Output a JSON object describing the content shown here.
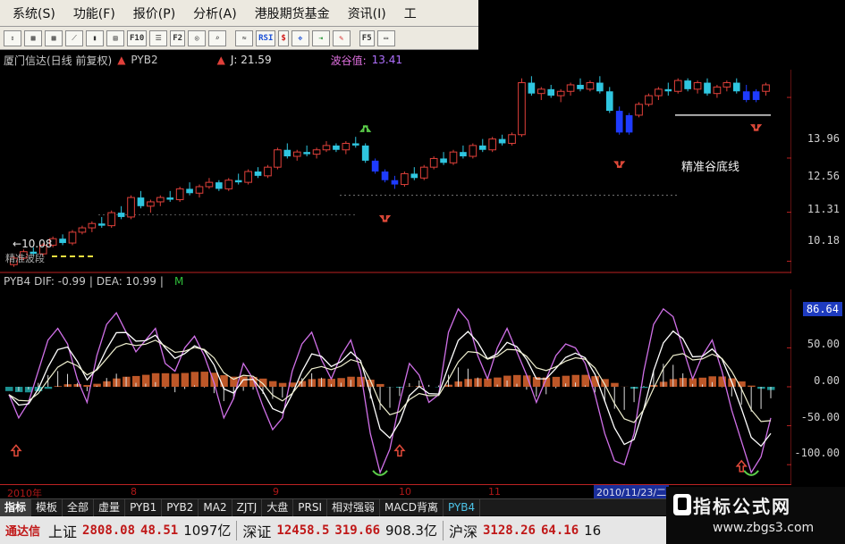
{
  "menu": [
    "系统(S)",
    "功能(F)",
    "报价(P)",
    "分析(A)",
    "港股期货基金",
    "资讯(I)",
    "工"
  ],
  "toolbar": {
    "buttons": [
      {
        "label": "",
        "icon": "arrow-updown-icon"
      },
      {
        "label": "",
        "icon": "grid-icon"
      },
      {
        "label": "",
        "icon": "grid-icon"
      },
      {
        "label": "",
        "icon": "line-chart-icon"
      },
      {
        "label": "",
        "icon": "candle-chart-icon"
      },
      {
        "label": "",
        "icon": "pane-icon"
      },
      {
        "label": "F10",
        "icon": "f10-icon"
      },
      {
        "label": "",
        "icon": "list-icon"
      },
      {
        "label": "F2",
        "icon": "f2-icon"
      },
      {
        "label": "",
        "icon": "scope-icon"
      },
      {
        "label": "",
        "icon": "search-icon"
      },
      {
        "label": "",
        "icon": "wave-icon"
      },
      {
        "label": "RSI",
        "icon": "rsi-icon"
      },
      {
        "label": "$",
        "icon": "dollar-icon"
      },
      {
        "label": "",
        "icon": "move-icon"
      },
      {
        "label": "",
        "icon": "export-icon"
      },
      {
        "label": "",
        "icon": "pencil-icon"
      },
      {
        "label": "F5",
        "icon": "f5-icon"
      },
      {
        "label": "",
        "icon": "window-icon"
      }
    ]
  },
  "price_panel": {
    "stock": "厦门信达(日线 前复权)",
    "indicator": "PYB2",
    "j_label": "J: 21.59",
    "valley_label": "波谷值:",
    "valley_value": "13.41",
    "low_price": "10.08",
    "faint_tag": "精准波段",
    "annotation": "精准谷底线"
  },
  "osc_panel": {
    "name": "PYB4",
    "dif": "DIF: -0.99",
    "dea": "DEA: 10.99",
    "m": "M"
  },
  "price_axis": [
    "13.96",
    "12.56",
    "11.31",
    "10.18"
  ],
  "osc_axis": [
    "50.00",
    "0.00",
    "-50.00",
    "-100.00"
  ],
  "osc_current": "86.64",
  "dates": [
    "2010年",
    "8",
    "9",
    "10",
    "11"
  ],
  "date_current": "2010/11/23/二",
  "tabs": [
    "指标",
    "模板",
    "全部",
    "虚量",
    "PYB1",
    "PYB2",
    "MA2",
    "ZJTJ",
    "大盘",
    "PRSI",
    "相对强弱",
    "MACD背离",
    "PYB4"
  ],
  "ticker": {
    "brand": "通达信",
    "items": [
      {
        "name": "上证",
        "value": "2808.08",
        "change": "48.51",
        "volume": "1097亿"
      },
      {
        "name": "深证",
        "value": "12458.5",
        "change": "319.66",
        "volume": "908.3亿"
      },
      {
        "name": "沪深",
        "value": "3128.26",
        "change": "64.16",
        "volume": "16"
      }
    ]
  },
  "logo": {
    "title": "指标公式网",
    "url": "www.zbgs3.com"
  },
  "chart_data": {
    "type": "candlestick",
    "colors": {
      "up": "#e0403a",
      "down": "#2fc6e0",
      "valley": "#1e3bff",
      "dif": "#ffffff",
      "k": "#d070e8",
      "dea": "#f0f0d0"
    },
    "ohlc": [
      [
        10.1,
        10.3,
        10.05,
        10.25
      ],
      [
        10.25,
        10.45,
        10.2,
        10.4
      ],
      [
        10.4,
        10.5,
        10.3,
        10.35
      ],
      [
        10.35,
        10.6,
        10.3,
        10.55
      ],
      [
        10.55,
        10.75,
        10.5,
        10.7
      ],
      [
        10.7,
        10.8,
        10.55,
        10.6
      ],
      [
        10.6,
        10.9,
        10.55,
        10.85
      ],
      [
        10.85,
        11.0,
        10.8,
        10.95
      ],
      [
        10.95,
        11.1,
        10.85,
        11.05
      ],
      [
        11.05,
        11.2,
        10.95,
        11.0
      ],
      [
        11.0,
        11.35,
        10.95,
        11.3
      ],
      [
        11.3,
        11.45,
        11.15,
        11.2
      ],
      [
        11.2,
        11.7,
        11.15,
        11.65
      ],
      [
        11.65,
        11.8,
        11.4,
        11.45
      ],
      [
        11.45,
        11.6,
        11.3,
        11.55
      ],
      [
        11.55,
        11.7,
        11.45,
        11.65
      ],
      [
        11.65,
        11.8,
        11.55,
        11.6
      ],
      [
        11.6,
        11.9,
        11.55,
        11.85
      ],
      [
        11.85,
        12.0,
        11.7,
        11.75
      ],
      [
        11.75,
        11.95,
        11.65,
        11.9
      ],
      [
        11.9,
        12.1,
        11.85,
        12.0
      ],
      [
        12.0,
        12.05,
        11.8,
        11.85
      ],
      [
        11.85,
        12.1,
        11.8,
        12.05
      ],
      [
        12.05,
        12.2,
        11.95,
        12.0
      ],
      [
        12.0,
        12.3,
        11.95,
        12.25
      ],
      [
        12.25,
        12.35,
        12.1,
        12.15
      ],
      [
        12.15,
        12.4,
        12.1,
        12.35
      ],
      [
        12.35,
        12.8,
        12.3,
        12.75
      ],
      [
        12.75,
        12.9,
        12.55,
        12.6
      ],
      [
        12.6,
        12.75,
        12.5,
        12.7
      ],
      [
        12.7,
        12.85,
        12.6,
        12.65
      ],
      [
        12.65,
        12.8,
        12.55,
        12.75
      ],
      [
        12.75,
        12.95,
        12.7,
        12.85
      ],
      [
        12.85,
        12.9,
        12.7,
        12.75
      ],
      [
        12.75,
        12.95,
        12.65,
        12.9
      ],
      [
        12.9,
        13.05,
        12.8,
        12.85
      ],
      [
        12.85,
        12.9,
        12.45,
        12.5
      ],
      [
        12.5,
        12.55,
        12.2,
        12.25
      ],
      [
        12.25,
        12.3,
        12.0,
        12.05
      ],
      [
        12.05,
        12.15,
        11.85,
        11.95
      ],
      [
        11.95,
        12.25,
        11.9,
        12.2
      ],
      [
        12.2,
        12.35,
        12.05,
        12.1
      ],
      [
        12.1,
        12.4,
        12.05,
        12.35
      ],
      [
        12.35,
        12.6,
        12.3,
        12.55
      ],
      [
        12.55,
        12.7,
        12.4,
        12.45
      ],
      [
        12.45,
        12.75,
        12.4,
        12.7
      ],
      [
        12.7,
        12.85,
        12.55,
        12.6
      ],
      [
        12.6,
        12.9,
        12.55,
        12.85
      ],
      [
        12.85,
        13.0,
        12.7,
        12.75
      ],
      [
        12.75,
        13.05,
        12.7,
        13.0
      ],
      [
        13.0,
        13.1,
        12.85,
        12.9
      ],
      [
        12.9,
        13.15,
        12.85,
        13.1
      ],
      [
        13.1,
        14.4,
        13.05,
        14.3
      ],
      [
        14.3,
        14.45,
        14.0,
        14.05
      ],
      [
        14.05,
        14.2,
        13.9,
        14.15
      ],
      [
        14.15,
        14.25,
        13.95,
        14.0
      ],
      [
        14.0,
        14.15,
        13.85,
        14.1
      ],
      [
        14.1,
        14.3,
        14.0,
        14.25
      ],
      [
        14.25,
        14.4,
        14.1,
        14.15
      ],
      [
        14.15,
        14.35,
        14.1,
        14.3
      ],
      [
        14.3,
        14.45,
        14.05,
        14.1
      ],
      [
        14.1,
        14.2,
        13.6,
        13.65
      ],
      [
        13.65,
        13.75,
        13.1,
        13.15
      ],
      [
        13.15,
        13.6,
        13.1,
        13.55
      ],
      [
        13.55,
        13.85,
        13.5,
        13.8
      ],
      [
        13.8,
        14.05,
        13.75,
        14.0
      ],
      [
        14.0,
        14.2,
        13.9,
        14.15
      ],
      [
        14.15,
        14.3,
        14.0,
        14.1
      ],
      [
        14.1,
        14.4,
        14.05,
        14.35
      ],
      [
        14.35,
        14.4,
        14.1,
        14.15
      ],
      [
        14.15,
        14.35,
        14.05,
        14.3
      ],
      [
        14.3,
        14.4,
        14.0,
        14.05
      ],
      [
        14.05,
        14.25,
        13.95,
        14.2
      ],
      [
        14.2,
        14.35,
        14.1,
        14.3
      ],
      [
        14.3,
        14.4,
        14.05,
        14.1
      ],
      [
        14.1,
        14.25,
        13.85,
        13.9
      ],
      [
        13.9,
        14.15,
        13.85,
        14.1
      ],
      [
        14.1,
        14.3,
        14.0,
        14.25
      ]
    ],
    "valley_bars": [
      37,
      38,
      39,
      62,
      63,
      75,
      76
    ],
    "osc": {
      "k": [
        -10,
        -40,
        -20,
        20,
        60,
        75,
        55,
        10,
        -20,
        40,
        80,
        95,
        70,
        45,
        60,
        75,
        30,
        20,
        50,
        65,
        40,
        5,
        -40,
        -15,
        30,
        10,
        -25,
        -55,
        -40,
        20,
        55,
        70,
        35,
        10,
        40,
        60,
        20,
        -60,
        -110,
        -80,
        -20,
        30,
        15,
        -20,
        -10,
        70,
        100,
        85,
        40,
        10,
        50,
        75,
        45,
        15,
        -20,
        10,
        40,
        55,
        50,
        30,
        -10,
        -60,
        -95,
        -100,
        -60,
        20,
        80,
        100,
        90,
        50,
        10,
        40,
        60,
        20,
        -30,
        -70,
        -110,
        -90,
        -40
      ]
    },
    "ylim_price": [
      9.9,
      14.6
    ],
    "ylim_osc": [
      -125,
      125
    ],
    "xlabel": "",
    "ylabel": ""
  }
}
